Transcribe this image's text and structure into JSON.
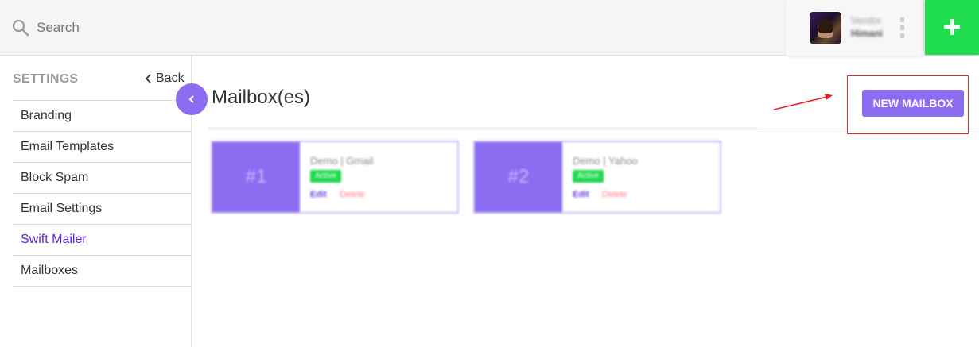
{
  "header": {
    "search": {
      "placeholder": "Search",
      "icon": "search-icon"
    },
    "user": {
      "role": "Vendor",
      "name": "Himani"
    },
    "add_icon": "plus-icon",
    "add_color": "#21dd50"
  },
  "sidebar": {
    "title": "SETTINGS",
    "back_label": "Back",
    "items": [
      {
        "label": "Branding",
        "active": false
      },
      {
        "label": "Email Templates",
        "active": false
      },
      {
        "label": "Block Spam",
        "active": false
      },
      {
        "label": "Email Settings",
        "active": false
      },
      {
        "label": "Swift Mailer",
        "active": true
      },
      {
        "label": "Mailboxes",
        "active": false
      }
    ],
    "active_color": "#5a22d6"
  },
  "main": {
    "title": "Mailbox(es)",
    "new_button_label": "NEW MAILBOX",
    "accent_color": "#8c6cf0",
    "annotation_color": "#e8242a",
    "mailboxes": [
      {
        "number": "#1",
        "name": "Demo | Gmail",
        "status": "Active",
        "edit_label": "Edit",
        "delete_label": "Delete"
      },
      {
        "number": "#2",
        "name": "Demo | Yahoo",
        "status": "Active",
        "edit_label": "Edit",
        "delete_label": "Delete"
      }
    ]
  }
}
